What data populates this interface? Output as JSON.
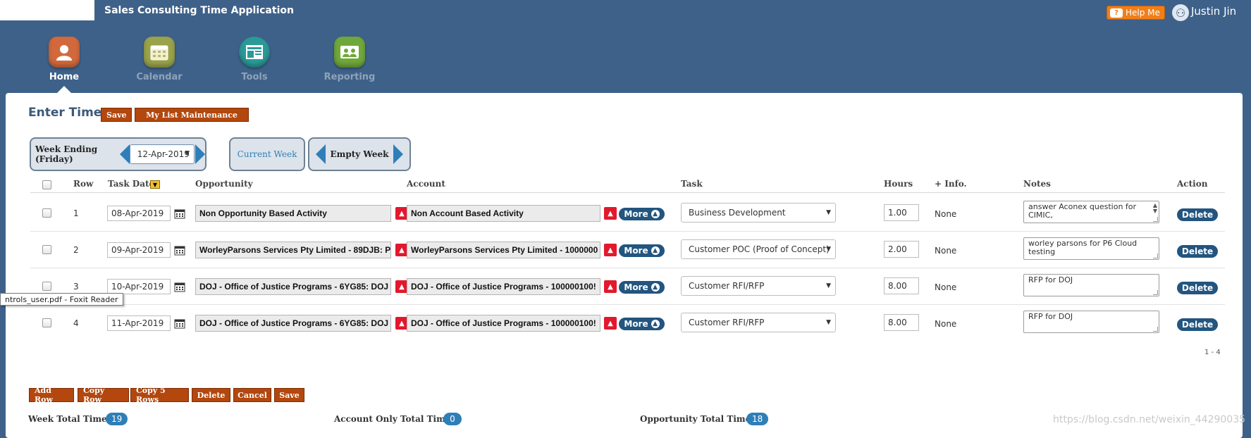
{
  "app": {
    "title": "Sales Consulting Time Application",
    "help_label": "Help Me",
    "user_name": "Justin Jin"
  },
  "nav": [
    {
      "label": "Home",
      "active": true,
      "color": "#d2693c",
      "icon": "user-icon"
    },
    {
      "label": "Calendar",
      "active": false,
      "color": "#9aa24a",
      "icon": "calendar-icon"
    },
    {
      "label": "Tools",
      "active": false,
      "color": "#2a9a98",
      "icon": "tools-icon"
    },
    {
      "label": "Reporting",
      "active": false,
      "color": "#6fa83a",
      "icon": "reporting-icon"
    }
  ],
  "enter_time": {
    "title": "Enter Time",
    "save_label": "Save",
    "my_list_label": "My List Maintenance"
  },
  "week": {
    "ending_label": "Week Ending (Friday)",
    "selected_date": "12-Apr-2019",
    "current_week_label": "Current Week",
    "empty_week_label": "Empty Week"
  },
  "table": {
    "headers": {
      "row": "Row",
      "task_date": "Task Date",
      "opportunity": "Opportunity",
      "account": "Account",
      "task": "Task",
      "hours": "Hours",
      "info": "+ Info.",
      "notes": "Notes",
      "action": "Action"
    },
    "more_label": "More",
    "delete_label": "Delete",
    "rows": [
      {
        "row": "1",
        "date": "08-Apr-2019",
        "opportunity": "Non Opportunity Based Activity",
        "account": "Non Account Based Activity",
        "task": "Business Development",
        "hours": "1.00",
        "info": "None",
        "notes": "answer Aconex question for CIMIC,"
      },
      {
        "row": "2",
        "date": "09-Apr-2019",
        "opportunity": "WorleyParsons Services Pty Limited - 89DJB: P",
        "account": "WorleyParsons Services Pty Limited - 1000000",
        "task": "Customer POC (Proof of Concept)",
        "hours": "2.00",
        "info": "None",
        "notes": "worley parsons for P6 Cloud testing"
      },
      {
        "row": "3",
        "date": "10-Apr-2019",
        "opportunity": "DOJ - Office of Justice Programs - 6YG85: DOJ",
        "account": "DOJ - Office of Justice Programs - 100000100!",
        "task": "Customer RFI/RFP",
        "hours": "8.00",
        "info": "None",
        "notes": "RFP for DOJ"
      },
      {
        "row": "4",
        "date": "11-Apr-2019",
        "opportunity": "DOJ - Office of Justice Programs - 6YG85: DOJ",
        "account": "DOJ - Office of Justice Programs - 100000100!",
        "task": "Customer RFI/RFP",
        "hours": "8.00",
        "info": "None",
        "notes": "RFP for DOJ"
      }
    ],
    "pager": "1 - 4"
  },
  "tooltip": "ntrols_user.pdf - Foxit Reader",
  "bottom_buttons": {
    "add_row": "Add Row",
    "copy_row": "Copy Row",
    "copy_5_rows": "Copy 5 Rows",
    "delete": "Delete",
    "cancel": "Cancel",
    "save": "Save"
  },
  "totals": {
    "week_label": "Week Total Time",
    "week_value": "19",
    "account_label": "Account Only Total Time",
    "account_value": "0",
    "opportunity_label": "Opportunity Total Time",
    "opportunity_value": "18"
  },
  "watermark": "https://blog.csdn.net/weixin_44290035"
}
